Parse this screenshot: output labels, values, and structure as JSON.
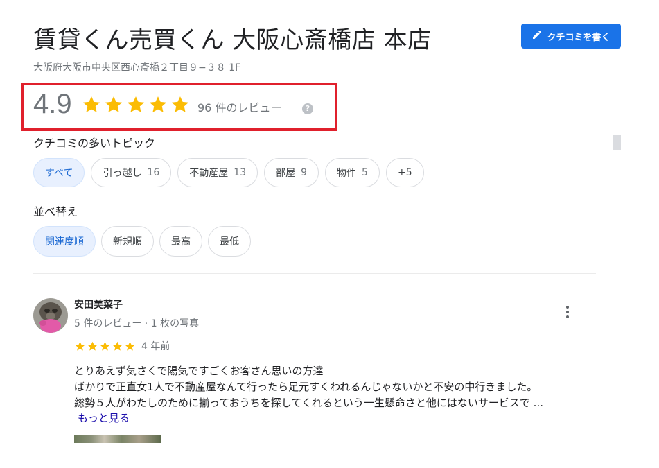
{
  "place": {
    "title": "賃貸くん売買くん 大阪心斎橋店 本店",
    "address": "大阪府大阪市中央区西心斎橋２丁目９−３８ 1F",
    "write_review_label": "クチコミを書く"
  },
  "rating": {
    "score": "4.9",
    "stars": 5,
    "review_count_text": "96 件のレビュー",
    "help_glyph": "?"
  },
  "topics": {
    "label": "クチコミの多いトピック",
    "chips": [
      {
        "label": "すべて",
        "count": ""
      },
      {
        "label": "引っ越し",
        "count": "16"
      },
      {
        "label": "不動産屋",
        "count": "13"
      },
      {
        "label": "部屋",
        "count": "9"
      },
      {
        "label": "物件",
        "count": "5"
      },
      {
        "label": "+5",
        "count": ""
      }
    ]
  },
  "sort": {
    "label": "並べ替え",
    "options": [
      "関連度順",
      "新規順",
      "最高",
      "最低"
    ]
  },
  "review": {
    "author": "安田美菜子",
    "meta": "5 件のレビュー · 1 枚の写真",
    "stars": 5,
    "age": "4 年前",
    "lines": [
      "とりあえず気さくで陽気ですごくお客さん思いの方達",
      "ばかりで正直女1人で不動産屋なんて行ったら足元すくわれるんじゃないかと不安の中行きました。",
      "総勢５人がわたしのために揃っておうちを探してくれるという一生懸命さと他にはないサービスで ..."
    ],
    "more_label": "もっと見る"
  },
  "colors": {
    "star": "#fbbc04",
    "accent": "#1a73e8",
    "highlight_box": "#e0202c",
    "selected_chip_bg": "#e8f0fe"
  },
  "icons": {
    "write": "pencil-icon",
    "help": "help-icon",
    "more": "more-vert-icon"
  }
}
